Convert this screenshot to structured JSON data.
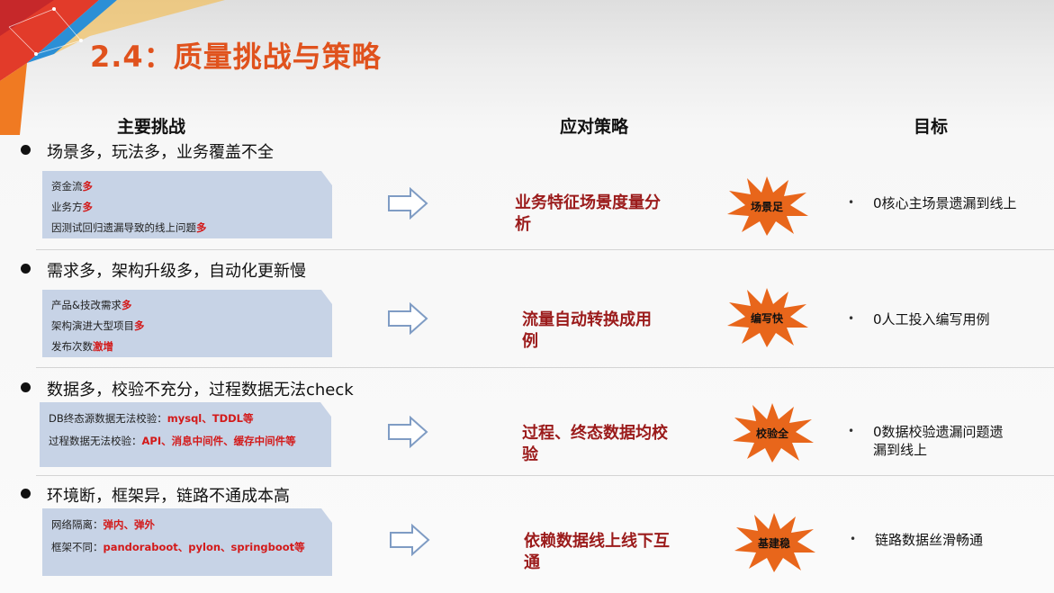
{
  "slide": {
    "title": "2.4：质量挑战与策略",
    "columns": {
      "challenge": "主要挑战",
      "strategy": "应对策略",
      "goal": "目标"
    }
  },
  "rows": [
    {
      "heading": "场景多，玩法多，业务覆盖不全",
      "lines": [
        {
          "text": "资金流",
          "highlight": "多"
        },
        {
          "text": "业务方",
          "highlight": "多"
        },
        {
          "text": "因测试回归遗漏导致的线上问题",
          "highlight": "多"
        }
      ],
      "strategy": [
        "业务特征场景度量分",
        "析"
      ],
      "badge": "场景足",
      "goal": [
        "0核心主场景遗漏到线上"
      ]
    },
    {
      "heading": "需求多，架构升级多，自动化更新慢",
      "lines": [
        {
          "text": "产品&技改需求",
          "highlight": "多"
        },
        {
          "text": "架构演进大型项目",
          "highlight": "多"
        },
        {
          "text": "发布次数",
          "highlight": "激增"
        }
      ],
      "strategy": [
        "流量自动转换成用",
        "例"
      ],
      "badge": "编写快",
      "goal": [
        "0人工投入编写用例"
      ]
    },
    {
      "heading": "数据多，校验不充分，过程数据无法check",
      "lines": [
        {
          "text": "DB终态源数据无法校验：",
          "highlight": "mysql、TDDL等"
        },
        {
          "text": "过程数据无法校验：",
          "highlight": "API、消息中间件、缓存中间件等"
        }
      ],
      "strategy": [
        "过程、终态数据均校",
        "验"
      ],
      "badge": "校验全",
      "goal": [
        "0数据校验遗漏问题遗",
        "漏到线上"
      ]
    },
    {
      "heading": "环境断，框架异，链路不通成本高",
      "lines": [
        {
          "text": "网络隔离：",
          "highlight": "弹内、弹外"
        },
        {
          "text": "框架不同：",
          "highlight": "pandoraboot、pylon、springboot等"
        }
      ],
      "strategy": [
        "依赖数据线上线下互",
        "通"
      ],
      "badge": "基建稳",
      "goal": [
        "链路数据丝滑畅通"
      ]
    }
  ],
  "colors": {
    "title": "#e0521d",
    "strategy": "#9b1b1b",
    "highlight": "#d31a1a",
    "box": "#c7d3e6",
    "burst": "#e8661b",
    "arrow": "#7f9cc4"
  }
}
